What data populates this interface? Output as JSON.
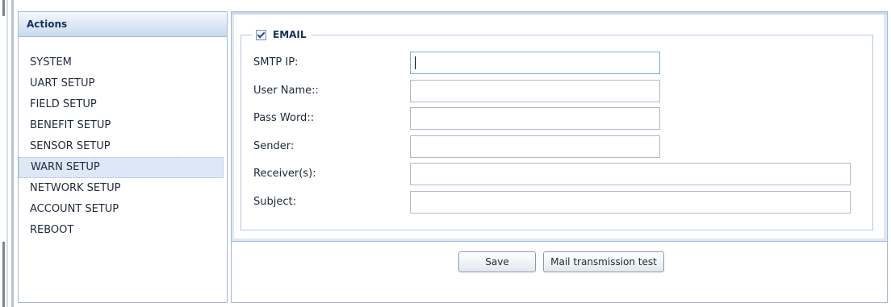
{
  "sidebar": {
    "title": "Actions",
    "items": [
      {
        "label": "SYSTEM"
      },
      {
        "label": "UART SETUP"
      },
      {
        "label": "FIELD SETUP"
      },
      {
        "label": "BENEFIT SETUP"
      },
      {
        "label": "SENSOR SETUP"
      },
      {
        "label": "WARN SETUP",
        "selected": true
      },
      {
        "label": "NETWORK SETUP"
      },
      {
        "label": "ACCOUNT SETUP"
      },
      {
        "label": "REBOOT"
      }
    ]
  },
  "email_section": {
    "legend": "EMAIL",
    "checked": true,
    "fields": [
      {
        "label": "SMTP IP:",
        "value": ""
      },
      {
        "label": "User Name::",
        "value": ""
      },
      {
        "label": "Pass Word::",
        "value": ""
      },
      {
        "label": "Sender:",
        "value": ""
      },
      {
        "label": "Receiver(s):",
        "value": ""
      },
      {
        "label": "Subject:",
        "value": ""
      }
    ]
  },
  "buttons": {
    "save": "Save",
    "test": "Mail transmission test"
  },
  "colors": {
    "header_gradient_top": "#f4f8fd",
    "header_gradient_bottom": "#c8d9ee",
    "selected_bg": "#dde8f7",
    "border": "#a7b8cf"
  }
}
